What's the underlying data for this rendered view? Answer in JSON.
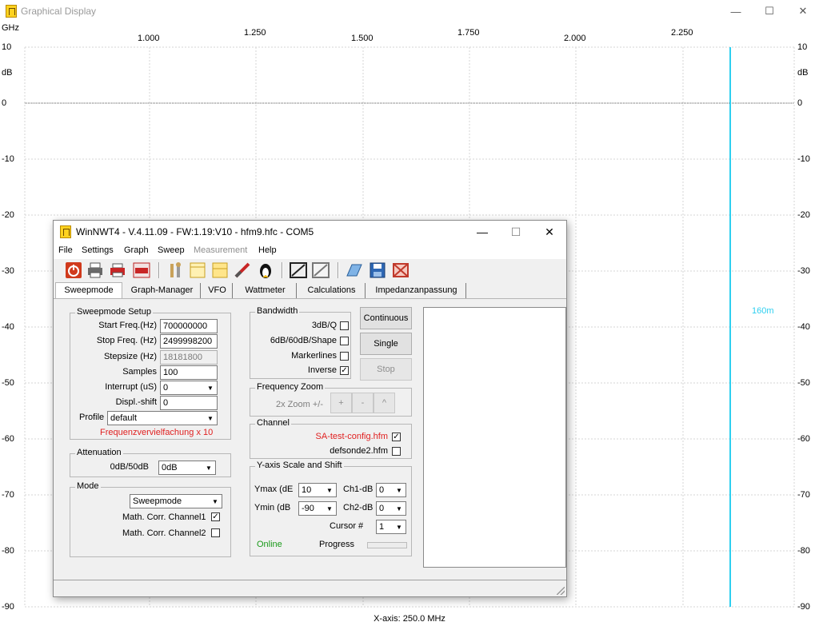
{
  "outer": {
    "title": "Graphical Display",
    "min_glyph": "—",
    "max_glyph": "☐",
    "close_glyph": "✕"
  },
  "graph": {
    "x_unit": "GHz",
    "y_unit": "dB",
    "x_ticks": [
      "1.000",
      "1.250",
      "1.500",
      "1.750",
      "2.000",
      "2.250"
    ],
    "y_ticks": [
      "10",
      "0",
      "-10",
      "-20",
      "-30",
      "-40",
      "-50",
      "-60",
      "-70",
      "-80",
      "-90"
    ],
    "marker_label": "160m",
    "x_axis_label": "X-axis: 250.0 MHz",
    "colors": {
      "grid": "#d4d4d4",
      "marker": "#2ecff0",
      "reference": "#666666"
    }
  },
  "dialog": {
    "title": "WinNWT4 - V.4.11.09 - FW:1.19:V10 - hfm9.hfc - COM5",
    "min_glyph": "—",
    "max_glyph": "☐",
    "close_glyph": "✕",
    "menu": [
      "File",
      "Settings",
      "Graph",
      "Sweep",
      "Measurement",
      "Help"
    ],
    "toolbar_icons": [
      "power-icon",
      "printer-icon",
      "printer-red-icon",
      "pdf-icon",
      "tools-icon",
      "frame-icon",
      "note-icon",
      "probe-icon",
      "penguin-icon",
      "calibrate-icon",
      "calibrate-gray-icon",
      "open-folder-icon",
      "save-icon",
      "delete-icon"
    ],
    "tabs": [
      "Sweepmode",
      "Graph-Manager",
      "VFO",
      "Wattmeter",
      "Calculations",
      "Impedanzanpassung"
    ],
    "sweepmode_setup": {
      "title": "Sweepmode Setup",
      "start_label": "Start Freq.(Hz)",
      "start_value": "700000000",
      "stop_label": "Stop Freq. (Hz)",
      "stop_value": "2499998200",
      "step_label": "Stepsize (Hz)",
      "step_value": "18181800",
      "samples_label": "Samples",
      "samples_value": "100",
      "interrupt_label": "Interrupt (uS)",
      "interrupt_value": "0",
      "displ_label": "Displ.-shift",
      "displ_value": "0",
      "profile_label": "Profile",
      "profile_value": "default",
      "freq_mult": "Frequenzvervielfachung x 10"
    },
    "attenuation": {
      "title": "Attenuation",
      "label": "0dB/50dB",
      "value": "0dB"
    },
    "mode": {
      "title": "Mode",
      "value": "Sweepmode",
      "corr1_label": "Math. Corr. Channel1",
      "corr1_checked": true,
      "corr2_label": "Math. Corr. Channel2",
      "corr2_checked": false
    },
    "bandwidth": {
      "title": "Bandwidth",
      "items": [
        {
          "label": "3dB/Q",
          "checked": false
        },
        {
          "label": "6dB/60dB/Shape",
          "checked": false
        },
        {
          "label": "Markerlines",
          "checked": false
        },
        {
          "label": "Inverse",
          "checked": true
        }
      ]
    },
    "buttons": {
      "continuous": "Continuous",
      "single": "Single",
      "stop": "Stop"
    },
    "freq_zoom": {
      "title": "Frequency Zoom",
      "label": "2x Zoom +/-",
      "plus": "+",
      "minus": "-",
      "caret": "^"
    },
    "channel": {
      "title": "Channel",
      "file1": "SA-test-config.hfm",
      "file1_checked": true,
      "file2": "defsonde2.hfm",
      "file2_checked": false
    },
    "yaxis": {
      "title": "Y-axis Scale and Shift",
      "ymax_label": "Ymax (dE",
      "ymax_value": "10",
      "ymin_label": "Ymin (dB",
      "ymin_value": "-90",
      "ch1_label": "Ch1-dB",
      "ch1_value": "0",
      "ch2_label": "Ch2-dB",
      "ch2_value": "0",
      "cursor_label": "Cursor #",
      "cursor_value": "1",
      "online": "Online",
      "progress_label": "Progress",
      "progress_value": 0
    }
  }
}
